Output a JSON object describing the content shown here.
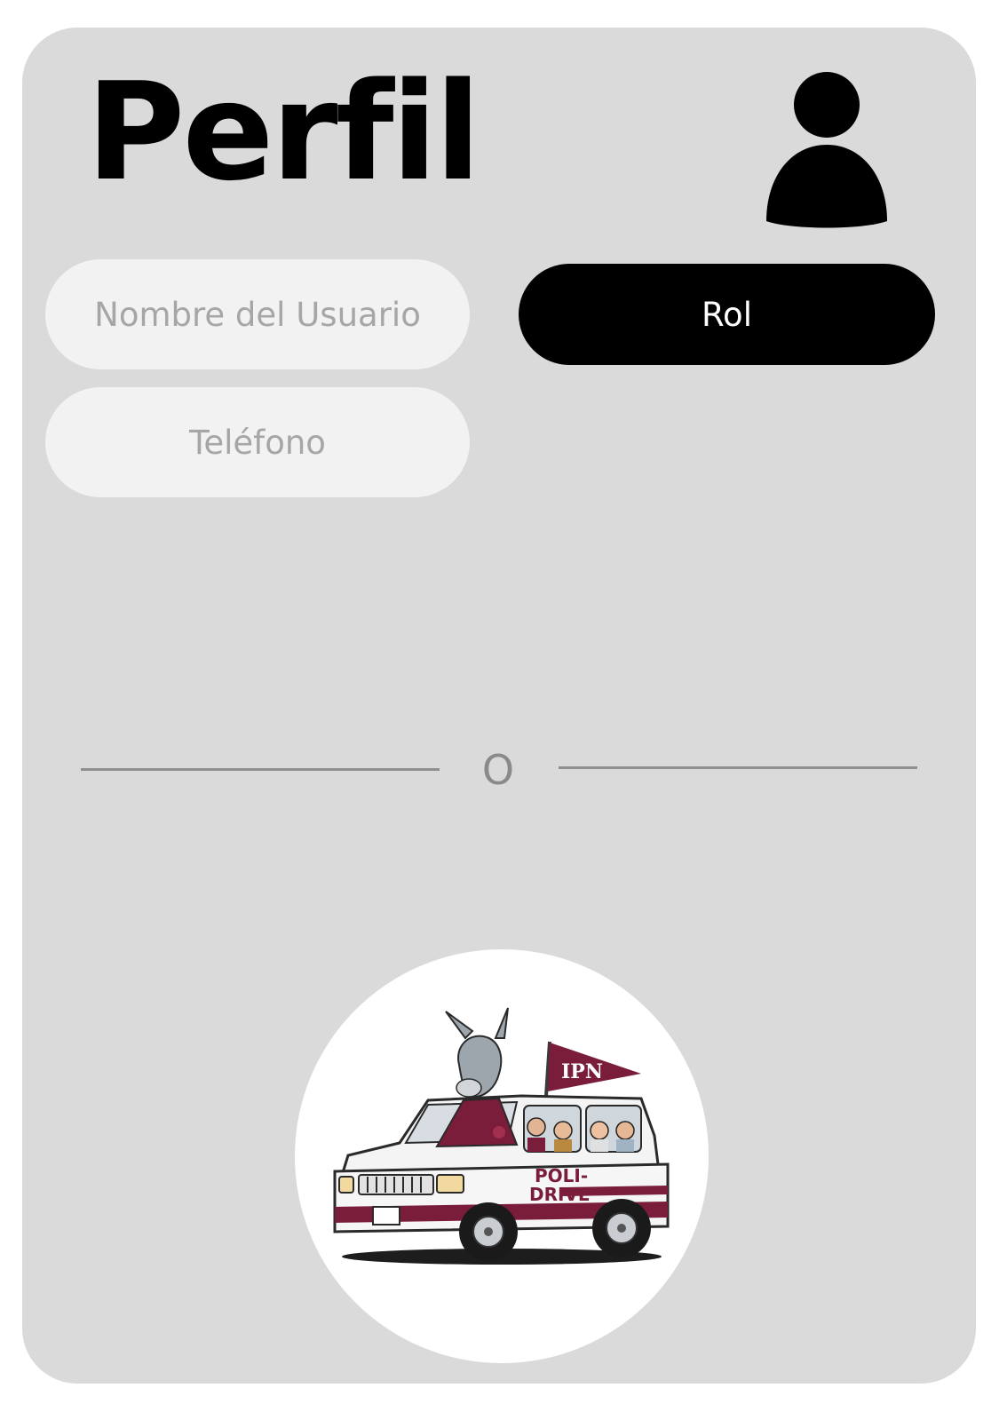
{
  "header": {
    "title": "Perfil",
    "avatar_icon": "user-icon"
  },
  "form": {
    "name_placeholder": "Nombre del Usuario",
    "phone_placeholder": "Teléfono",
    "role_label": "Rol"
  },
  "divider": {
    "text": "O"
  },
  "logo": {
    "flag_text": "IPN",
    "door_text_1": "POLI-",
    "door_text_2": "DRIVE",
    "badge_text": "IPN"
  },
  "colors": {
    "card_background": "#dadada",
    "input_background": "#f2f2f2",
    "button_background": "#000000",
    "brand_maroon": "#7a1d3a"
  }
}
